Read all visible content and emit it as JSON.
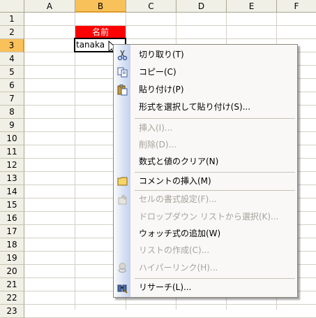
{
  "sheet": {
    "columns": [
      "A",
      "B",
      "C",
      "D",
      "E",
      "F"
    ],
    "active_column": "B",
    "rows": [
      "1",
      "2",
      "3",
      "4",
      "5",
      "6",
      "7",
      "8",
      "9",
      "10",
      "11",
      "12",
      "13",
      "14",
      "15",
      "16",
      "17",
      "18",
      "19",
      "20",
      "21",
      "22",
      "23"
    ],
    "active_row": "3",
    "cells": {
      "B2": "名前",
      "B3": "tanaka"
    },
    "header_bg": "#f1f0e7",
    "active_header_bg": "#f9c15a",
    "name_cell_bg": "#ff0000"
  },
  "context_menu": {
    "items": [
      {
        "label": "切り取り(T)",
        "icon": "scissors-icon",
        "enabled": true
      },
      {
        "label": "コピー(C)",
        "icon": "copy-icon",
        "enabled": true
      },
      {
        "label": "貼り付け(P)",
        "icon": "paste-icon",
        "enabled": true
      },
      {
        "label": "形式を選択して貼り付け(S)...",
        "icon": "",
        "enabled": true
      },
      {
        "label": "挿入(I)...",
        "icon": "",
        "enabled": false
      },
      {
        "label": "削除(D)...",
        "icon": "",
        "enabled": false
      },
      {
        "label": "数式と値のクリア(N)",
        "icon": "",
        "enabled": true
      },
      {
        "label": "コメントの挿入(M)",
        "icon": "comment-icon",
        "enabled": true
      },
      {
        "label": "セルの書式設定(F)...",
        "icon": "format-cells-icon",
        "enabled": false
      },
      {
        "label": "ドロップダウン リストから選択(K)...",
        "icon": "",
        "enabled": false
      },
      {
        "label": "ウォッチ式の追加(W)",
        "icon": "",
        "enabled": true
      },
      {
        "label": "リストの作成(C)...",
        "icon": "",
        "enabled": false
      },
      {
        "label": "ハイパーリンク(H)...",
        "icon": "hyperlink-icon",
        "enabled": false
      },
      {
        "label": "リサーチ(L)...",
        "icon": "research-icon",
        "enabled": true
      }
    ]
  }
}
